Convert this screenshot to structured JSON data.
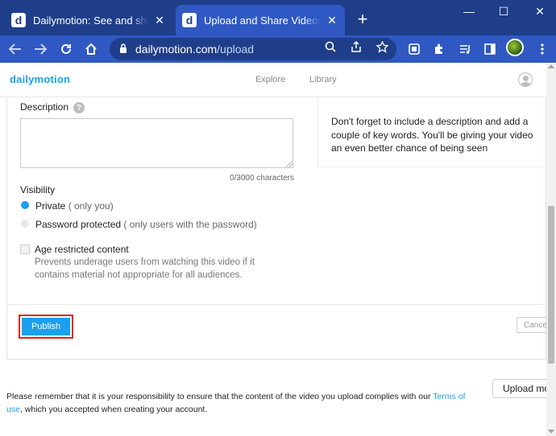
{
  "browser": {
    "tabs": [
      {
        "favicon": "d",
        "title": "Dailymotion: See and share the",
        "close": "✕"
      },
      {
        "favicon": "d",
        "title": "Upload and Share Videos | Dailymotion",
        "close": "✕"
      }
    ],
    "new_tab": "+",
    "window_controls": {
      "minimize": "—",
      "maximize": "☐",
      "close": "✕"
    },
    "url_host": "dailymotion.com",
    "url_path": "/upload",
    "icons": [
      "back-arrow-icon",
      "forward-arrow-icon",
      "reload-icon",
      "home-icon",
      "lock-icon",
      "zoom-icon",
      "share-icon",
      "star-icon",
      "screenshot-icon",
      "puzzle-icon",
      "reading-list-icon",
      "sidebar-icon",
      "profile-avatar-icon",
      "more-menu-icon"
    ]
  },
  "site": {
    "logo": "dailymotion",
    "nav": [
      "Explore",
      "Library"
    ]
  },
  "form": {
    "description_label": "Description",
    "help_glyph": "?",
    "description_value": "",
    "char_count": "0/3000 characters",
    "tip": "Don't forget to include a description and add a couple of key words. You'll be giving your video an even better chance of being seen",
    "visibility_label": "Visibility",
    "visibility_options": [
      {
        "label": "Private",
        "hint": "( only you)",
        "selected": true
      },
      {
        "label": "Password protected",
        "hint": "( only users with the password)",
        "selected": false
      }
    ],
    "age_restricted_label": "Age restricted content",
    "age_restricted_checked": false,
    "age_restricted_desc": "Prevents underage users from watching this video if it contains material not appropriate for all audiences.",
    "publish_label": "Publish",
    "cancel_label": "Cance"
  },
  "footer": {
    "text_before": "Please remember that it is your responsibility to ensure that the content of the video you upload complies with our ",
    "terms_link": "Terms of use",
    "text_after": ", which you accepted when creating your account.",
    "upload_more_label": "Upload mo"
  },
  "colors": {
    "tabbar": "#1f3e8a",
    "toolbar": "#2f58c3",
    "accent": "#1aa0f0",
    "highlight_border": "#e2231a"
  }
}
